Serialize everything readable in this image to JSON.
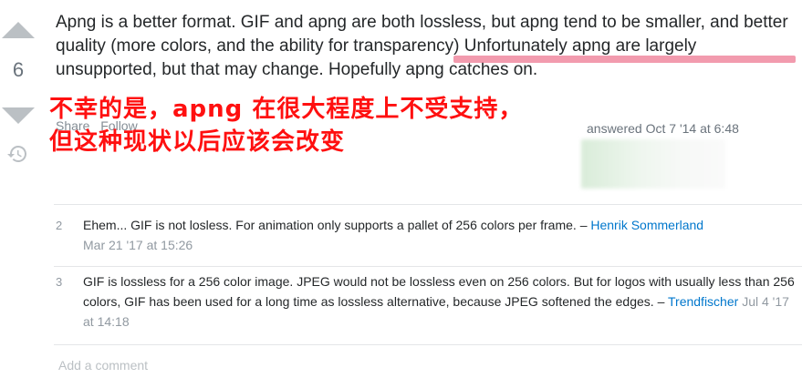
{
  "vote": {
    "count": "6"
  },
  "post": {
    "text_part1": "Apng is a better format. GIF and apng are both lossless, but apng tend to be smaller, and better quality (more colors, and the ability for transparency) ",
    "text_highlight": "Unfortunately apng are largely unsupported",
    "text_part2": ", but that may change. Hopefully apng catches on."
  },
  "annotation": {
    "line1": "不幸的是，apng 在很大程度上不受支持，",
    "line2": "但这种现状以后应该会改变",
    "highlight_color": "#f08aa0",
    "text_color": "#ff1010"
  },
  "menu": {
    "share": "Share",
    "follow": "Follow"
  },
  "signature": {
    "action": "answered Oct 7 '14 at 6:48"
  },
  "comments": [
    {
      "score": "2",
      "text": "Ehem... GIF is not losless. For animation only supports a pallet of 256 colors per frame. – ",
      "user": "Henrik Sommerland",
      "date": "Mar 21 '17 at 15:26"
    },
    {
      "score": "3",
      "text": "GIF is lossless for a 256 color image. JPEG would not be lossless even on 256 colors. But for logos with usually less than 256 colors, GIF has been used for a long time as lossless alternative, because JPEG softened the edges. – ",
      "user": "Trendfischer",
      "date": "Jul 4 '17 at 14:18"
    }
  ],
  "add_comment": "Add a comment"
}
